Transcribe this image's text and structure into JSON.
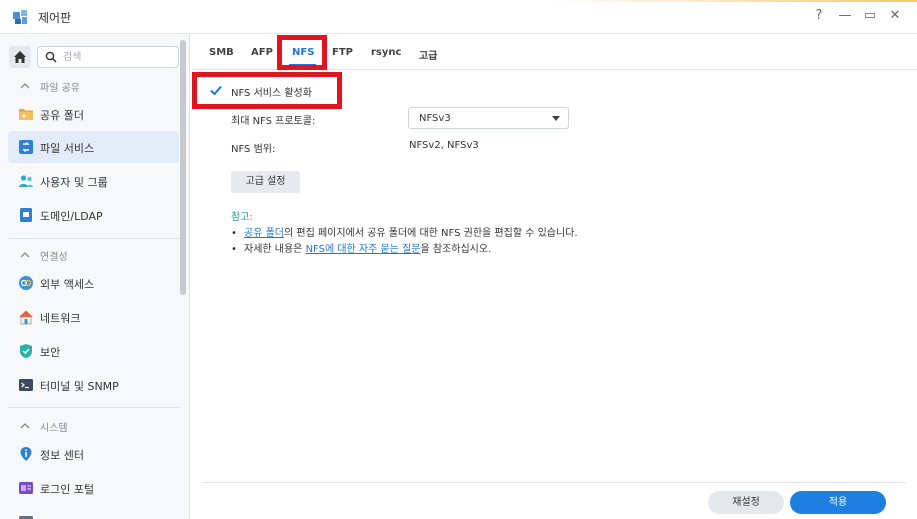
{
  "window": {
    "title": "제어판",
    "controls": [
      "?",
      "—",
      "▭",
      "✕"
    ]
  },
  "sidebar": {
    "search_placeholder": "검색",
    "groups": [
      {
        "label": "파일 공유",
        "items": [
          {
            "label": "공유 폴더",
            "icon": "folder-icon"
          },
          {
            "label": "파일 서비스",
            "icon": "file-services-icon",
            "active": true
          },
          {
            "label": "사용자 및 그룹",
            "icon": "users-icon"
          },
          {
            "label": "도메인/LDAP",
            "icon": "domain-icon"
          }
        ]
      },
      {
        "label": "연결성",
        "items": [
          {
            "label": "외부 액세스",
            "icon": "external-access-icon"
          },
          {
            "label": "네트워크",
            "icon": "network-icon"
          },
          {
            "label": "보안",
            "icon": "security-shield-icon"
          },
          {
            "label": "터미널 및 SNMP",
            "icon": "terminal-icon"
          }
        ]
      },
      {
        "label": "시스템",
        "items": [
          {
            "label": "정보 센터",
            "icon": "info-center-icon"
          },
          {
            "label": "로그인 포털",
            "icon": "login-portal-icon"
          }
        ]
      }
    ]
  },
  "tabs": [
    {
      "label": "SMB"
    },
    {
      "label": "AFP"
    },
    {
      "label": "NFS",
      "active": true
    },
    {
      "label": "FTP"
    },
    {
      "label": "rsync"
    },
    {
      "label": "고급"
    }
  ],
  "nfs": {
    "enable_label": "NFS 서비스 활성화",
    "enabled": true,
    "max_protocol_label": "최대 NFS 프로토콜:",
    "max_protocol_value": "NFSv3",
    "scope_label": "NFS 범위:",
    "scope_value": "NFSv2, NFSv3",
    "advanced_button": "고급 설정"
  },
  "note": {
    "title": "참고:",
    "line1_link": "공유 폴더",
    "line1_text": "의 편집 페이지에서 공유 폴더에 대한 NFS 권한을 편집할 수 있습니다.",
    "line2_prefix": "자세한 내용은 ",
    "line2_link": "NFS에 대한 자주 묻는 질문",
    "line2_suffix": "을 참조하십시오."
  },
  "footer": {
    "reset_label": "재설정",
    "apply_label": "적용"
  },
  "colors": {
    "accent": "#1e78cf",
    "apply_button": "#1e7fe0",
    "highlight_box": "#e3141e",
    "note_title": "#1a9c8f"
  }
}
